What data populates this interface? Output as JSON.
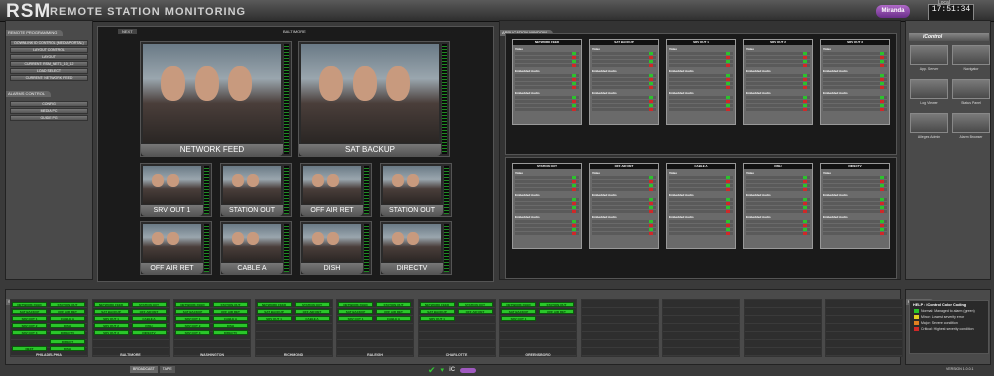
{
  "header": {
    "logo": "RSM",
    "title": "REMOTE STATION MONITORING",
    "brand": "Miranda",
    "clock_label": "Local",
    "clock_value": "17:51:34"
  },
  "colors": {
    "green": "#2ac62a",
    "red": "#d02828",
    "yellow": "#e0d020"
  },
  "left_panel": {
    "title": "REMOTE PROGRAMMING",
    "buttons": [
      "DOWNLINK ID CONTROL  (MEDIAPORTAL)",
      "LAYOUT CONTROL",
      "LAYOUT",
      "CURRENT: RSM_NET1_10_12",
      "LOAD SELECT",
      "CURRENT: NETWORK FEED"
    ],
    "buttons2_title": "ALARMS CONTROL",
    "buttons2": [
      "CONFIG",
      "MEDIA PC",
      "GUIDE PG"
    ]
  },
  "mv": {
    "tab": "NEXT",
    "title": "BALTIMORE",
    "big": [
      "NETWORK FEED",
      "SAT BACKUP"
    ],
    "small_row1": [
      "SRV OUT 1",
      "STATION OUT",
      "OFF AIR RET",
      "STATION OUT"
    ],
    "small_row2": [
      "OFF AIR RET",
      "CABLE A",
      "DISH",
      "DIRECTV"
    ]
  },
  "app_panel": {
    "title": "APPLICATION WINDOW"
  },
  "probes_top": [
    "NETWORK FEED",
    "SAT BACKUP",
    "SRV OUT 1",
    "SRV OUT 2",
    "SRV OUT 3"
  ],
  "probes_bottom": [
    "STATION OUT",
    "OFF AIR RET",
    "CABLE A",
    "DISH",
    "DIRECTV"
  ],
  "probe_labels": {
    "s1": "Video",
    "s2": "Embedded Audio",
    "s3": "Embedded Audio"
  },
  "right_panel": {
    "title": "iControl",
    "icons": [
      "App. Server",
      "Navigator",
      "Log Viewer",
      "Status Panel",
      "Alleges Admin",
      "Alarm Browser"
    ]
  },
  "bottom": {
    "title": "SINGLE SELECT OR",
    "groups": [
      {
        "name": "PHILADELPHIA",
        "btns": [
          "NETWORK FEED",
          "STATION OUT",
          "SAT BACKUP",
          "OFF AIR RET",
          "SRV OUT 1",
          "CABLE A",
          "SRV OUT 2",
          "DISH",
          "SRV OUT 3",
          "DIRECTV"
        ],
        "extra": [
          "DIRECT",
          "NEXT",
          "DISH"
        ]
      },
      {
        "name": "BALTIMORE",
        "btns": [
          "NETWORK FEED",
          "STATION OUT",
          "SAT BACKUP",
          "OFF AIR RET",
          "SRV OUT 1",
          "CABLE A",
          "SRV OUT 2",
          "DISH",
          "SRV OUT 3",
          "DIRECTV"
        ],
        "extra": []
      },
      {
        "name": "WASHINGTON",
        "btns": [
          "NETWORK FEED",
          "STATION OUT",
          "SAT BACKUP",
          "OFF AIR RET",
          "SRV OUT 1",
          "CABLE A",
          "SRV OUT 2",
          "DISH",
          "SRV OUT 3",
          "DIRECTV"
        ],
        "extra": []
      },
      {
        "name": "RICHMOND",
        "btns": [
          "NETWORK FEED",
          "STATION OUT",
          "SAT BACKUP",
          "OFF AIR RET",
          "SRV OUT 1",
          "CABLE A"
        ],
        "extra": []
      },
      {
        "name": "RALEIGH",
        "btns": [
          "NETWORK FEED",
          "STATION OUT",
          "SAT BACKUP",
          "OFF AIR RET",
          "SRV OUT 1",
          "CABLE A"
        ],
        "extra": []
      },
      {
        "name": "CHARLOTTE",
        "btns": [
          "NETWORK FEED",
          "STATION OUT",
          "SAT BACKUP",
          "OFF AIR RET",
          "SRV OUT 1"
        ],
        "extra": []
      },
      {
        "name": "GREENSBORO",
        "btns": [
          "NETWORK FEED",
          "STATION OUT",
          "SAT BACKUP",
          "OFF AIR RET",
          "SRV OUT 1"
        ],
        "extra": []
      }
    ],
    "tabs": [
      "BROADCAST",
      "TAPE"
    ]
  },
  "legend": {
    "title": "MESSAGE",
    "help": "HELP : iControl Color Coding",
    "items": [
      {
        "color": "#2ac62a",
        "label": "Normal: Managed to alarm (green)"
      },
      {
        "color": "#e0d020",
        "label": "Minor: Lowest severity error"
      },
      {
        "color": "#e08020",
        "label": "Major: Severe condition"
      },
      {
        "color": "#d02828",
        "label": "Critical: Highest severity condition"
      }
    ],
    "version": "VERSION 1.0.0.1"
  }
}
